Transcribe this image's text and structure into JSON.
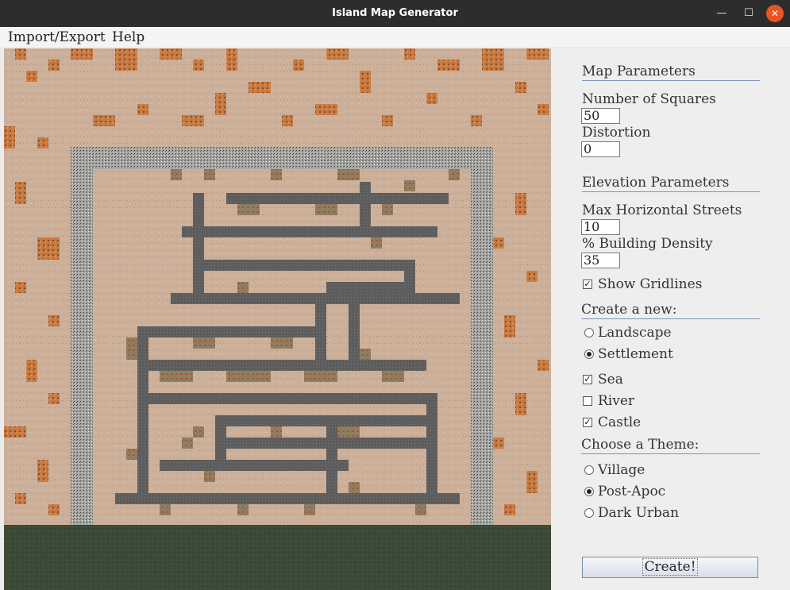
{
  "window": {
    "title": "Island Map Generator"
  },
  "menu": {
    "items": [
      "Import/Export",
      "Help"
    ]
  },
  "panel": {
    "map_params_title": "Map Parameters",
    "num_squares_label": "Number of Squares",
    "num_squares_value": "50",
    "distortion_label": "Distortion",
    "distortion_value": "0",
    "elevation_title": "Elevation Parameters",
    "max_streets_label": "Max Horizontal Streets",
    "max_streets_value": "10",
    "density_label": "% Building Density",
    "density_value": "35",
    "gridlines_label": "Show Gridlines",
    "gridlines_checked": true,
    "create_new_title": "Create a new:",
    "create_options": [
      {
        "label": "Landscape",
        "selected": false
      },
      {
        "label": "Settlement",
        "selected": true
      }
    ],
    "features": [
      {
        "label": "Sea",
        "checked": true
      },
      {
        "label": "River",
        "checked": false
      },
      {
        "label": "Castle",
        "checked": true
      }
    ],
    "theme_title": "Choose a Theme:",
    "themes": [
      {
        "label": "Village",
        "selected": false
      },
      {
        "label": "Post-Apoc",
        "selected": true
      },
      {
        "label": "Dark Urban",
        "selected": false
      }
    ],
    "create_button": "Create!"
  },
  "colors": {
    "sand": "#cdb09a",
    "rust": "#c0743c",
    "building": "#8a7a60",
    "road": "#5f5f60",
    "wall": "#a4a4a0",
    "grass": "#3b4a36",
    "accent": "#7d94b8"
  }
}
